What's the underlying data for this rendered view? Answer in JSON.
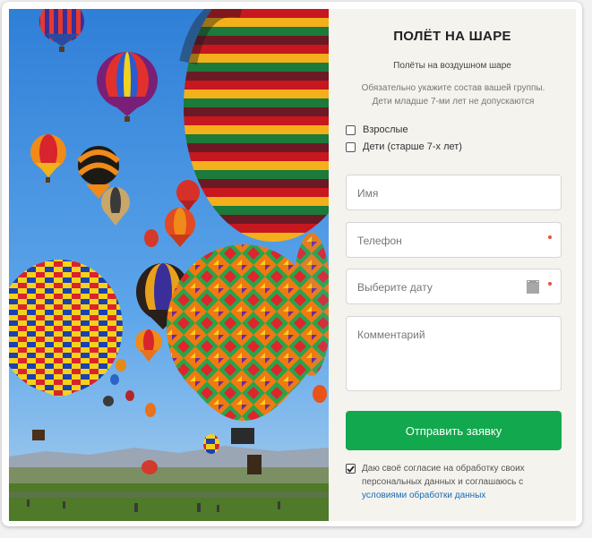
{
  "form": {
    "title": "ПОЛЁТ НА ШАРЕ",
    "subtitle": "Полёты на воздушном шаре",
    "note_line1": "Обязательно укажите состав вашей группы.",
    "note_line2": "Дети младше 7-ми лет не допускаются",
    "checkbox_adults": "Взрослые",
    "checkbox_children": "Дети (старше 7-х лет)",
    "name_placeholder": "Имя",
    "phone_placeholder": "Телефон",
    "date_placeholder": "Выберите дату",
    "comment_placeholder": "Комментарий",
    "submit_label": "Отправить заявку",
    "consent_text": "Даю своё согласие на обработку своих персональных данных и соглашаюсь с",
    "consent_link": "условиями обработки данных"
  },
  "state": {
    "adults_checked": false,
    "children_checked": false,
    "consent_checked": true
  },
  "colors": {
    "accent": "#12a84d",
    "required_dot": "#e7503d",
    "link": "#1a6bb5",
    "panel_bg": "#f4f3ee",
    "sky": "#3f8fe0"
  },
  "icons": [
    "calendar-icon",
    "checkmark-icon"
  ]
}
